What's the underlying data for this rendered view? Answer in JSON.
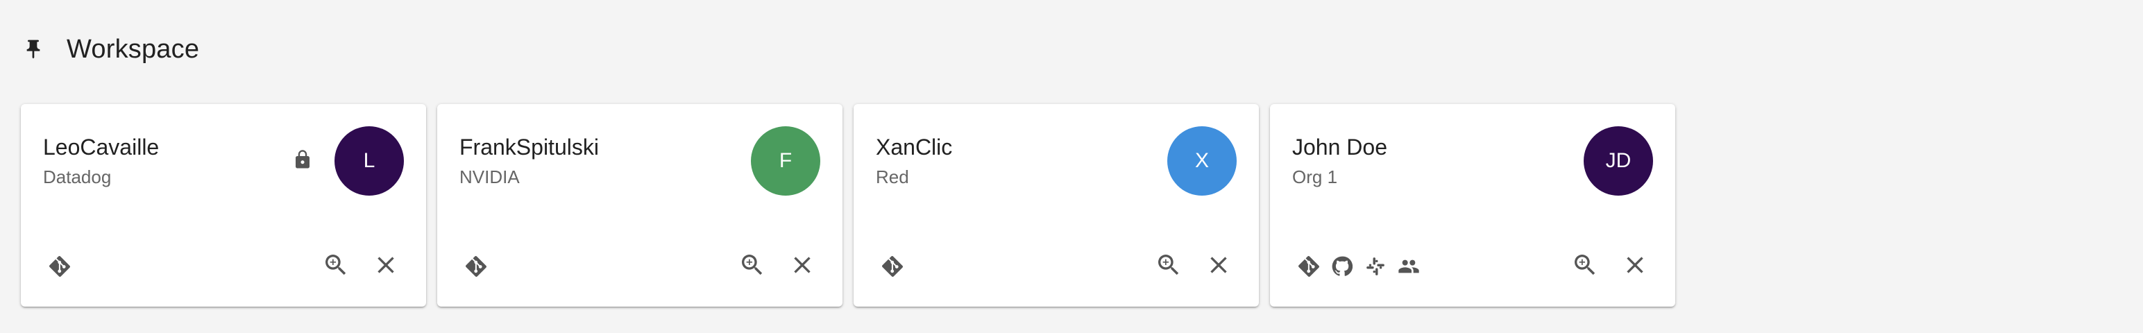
{
  "page": {
    "title": "Workspace"
  },
  "colors": {
    "background": "#f4f4f4",
    "card": "#ffffff",
    "icon": "#555555",
    "purple": "#2e0b4f",
    "green": "#4a9c5d",
    "blue": "#3f8fdd"
  },
  "cards": [
    {
      "name": "LeoCavaille",
      "org": "Datadog",
      "avatar_text": "L",
      "avatar_color": "#2e0b4f",
      "locked": true,
      "bottom_icons": [
        "git-icon"
      ],
      "actions": [
        "zoom-in-icon",
        "close-icon"
      ]
    },
    {
      "name": "FrankSpitulski",
      "org": "NVIDIA",
      "avatar_text": "F",
      "avatar_color": "#4a9c5d",
      "locked": false,
      "bottom_icons": [
        "git-icon"
      ],
      "actions": [
        "zoom-in-icon",
        "close-icon"
      ]
    },
    {
      "name": "XanClic",
      "org": "Red",
      "avatar_text": "X",
      "avatar_color": "#3f8fdd",
      "locked": false,
      "bottom_icons": [
        "git-icon"
      ],
      "actions": [
        "zoom-in-icon",
        "close-icon"
      ]
    },
    {
      "name": "John Doe",
      "org": "Org 1",
      "avatar_text": "JD",
      "avatar_color": "#2e0b4f",
      "locked": false,
      "bottom_icons": [
        "git-icon",
        "github-icon",
        "slack-icon",
        "people-icon"
      ],
      "actions": [
        "zoom-in-icon",
        "close-icon"
      ]
    }
  ]
}
